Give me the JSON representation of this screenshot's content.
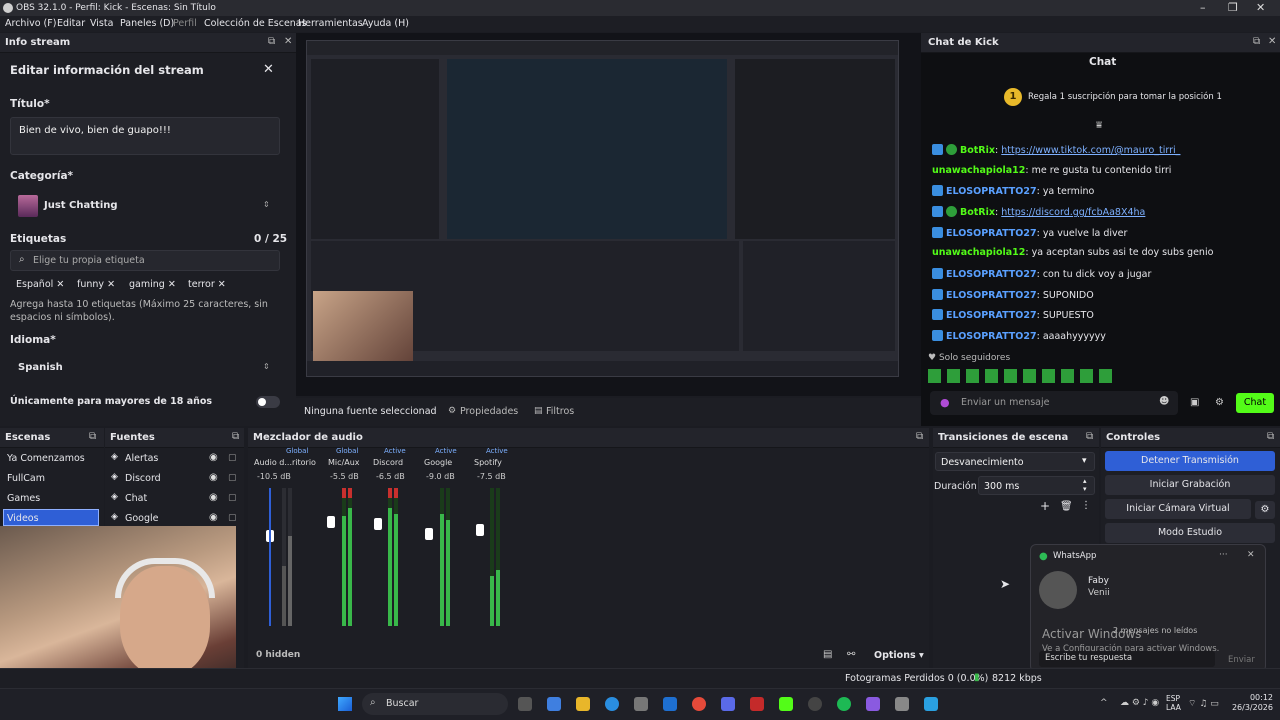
{
  "window": {
    "title": "OBS 32.1.0 - Perfil: Kick - Escenas: Sin Título"
  },
  "menu": [
    "Archivo (F)",
    "Editar",
    "Vista",
    "Paneles (D)",
    "Perfil",
    "Colección de Escenas",
    "Herramientas",
    "Ayuda (H)"
  ],
  "info_stream": {
    "dock_title": "Info stream",
    "heading": "Editar información del stream",
    "title_label": "Título*",
    "title_value": "Bien de vivo, bien de guapo!!!",
    "category_label": "Categoría*",
    "category_value": "Just Chatting",
    "tags_label": "Etiquetas",
    "tags_count": "0 / 25",
    "tags_placeholder": "Elige tu propia etiqueta",
    "tags": [
      "Español",
      "funny",
      "gaming",
      "terror"
    ],
    "tags_hint": "Agrega hasta 10 etiquetas (Máximo 25 caracteres, sin espacios ni símbolos).",
    "language_label": "Idioma*",
    "language_value": "Spanish",
    "adults_label": "Únicamente para mayores de 18 años"
  },
  "preview": {
    "no_source": "Ninguna fuente seleccionad",
    "properties": "Propiedades",
    "filters": "Filtros"
  },
  "chat": {
    "dock_title": "Chat de Kick",
    "header": "Chat",
    "pinned": "Regala 1 suscripción para tomar la posición 1",
    "messages": [
      {
        "user": "BotRix",
        "sep": ": ",
        "text": "https://www.tiktok.com/@mauro_tirri_",
        "link": true,
        "bot": true
      },
      {
        "user": "unawachapiola12",
        "sep": ": ",
        "text": "me re gusta tu contenido tirri",
        "link": false,
        "bot": false
      },
      {
        "user": "ELOSOPRATTO27",
        "sep": ": ",
        "text": "ya termino",
        "link": false,
        "bot": false
      },
      {
        "user": "BotRix",
        "sep": ": ",
        "text": "https://discord.gg/fcbAa8X4ha",
        "link": true,
        "bot": true
      },
      {
        "user": "ELOSOPRATTO27",
        "sep": ": ",
        "text": "ya vuelve la diver",
        "link": false,
        "bot": false
      },
      {
        "user": "unawachapiola12",
        "sep": ": ",
        "text": "ya aceptan subs asi te doy subs genio",
        "link": false,
        "bot": false
      },
      {
        "user": "ELOSOPRATTO27",
        "sep": ": ",
        "text": "con tu dick voy a jugar",
        "link": false,
        "bot": false
      },
      {
        "user": "ELOSOPRATTO27",
        "sep": ": ",
        "text": "SUPONIDO",
        "link": false,
        "bot": false
      },
      {
        "user": "ELOSOPRATTO27",
        "sep": ": ",
        "text": "SUPUESTO",
        "link": false,
        "bot": false
      },
      {
        "user": "ELOSOPRATTO27",
        "sep": ": ",
        "text": "aaaahyyyyyy",
        "link": false,
        "bot": false
      }
    ],
    "followers_only": "Solo seguidores",
    "input_placeholder": "Enviar un mensaje",
    "send": "Chat"
  },
  "scenes": {
    "title": "Escenas",
    "items": [
      "Ya Comenzamos",
      "FullCam",
      "Games",
      "Videos"
    ],
    "selected": 3
  },
  "sources": {
    "title": "Fuentes",
    "items": [
      "Alertas",
      "Discord",
      "Chat",
      "Google"
    ]
  },
  "mixer": {
    "title": "Mezclador de audio",
    "channels": [
      {
        "tag": "Global",
        "name": "Audio d...ritorio",
        "db": "-10.5 dB"
      },
      {
        "tag": "Global",
        "name": "Mic/Aux",
        "db": "-5.5 dB"
      },
      {
        "tag": "Active",
        "name": "Discord",
        "db": "-6.5 dB"
      },
      {
        "tag": "Active",
        "name": "Google",
        "db": "-9.0 dB"
      },
      {
        "tag": "Active",
        "name": "Spotify",
        "db": "-7.5 dB"
      }
    ],
    "scale": [
      "0",
      "-6",
      "-12",
      "-18",
      "-24",
      "-30",
      "-36",
      "-42",
      "-48",
      "-54",
      "-60"
    ],
    "hidden": "0 hidden",
    "options": "Options"
  },
  "transitions": {
    "title": "Transiciones de escena",
    "type": "Desvanecimiento",
    "duration_label": "Duración",
    "duration_value": "300 ms"
  },
  "controls": {
    "title": "Controles",
    "stop_stream": "Detener Transmisión",
    "start_recording": "Iniciar Grabación",
    "virtual_cam": "Iniciar Cámara Virtual",
    "studio_mode": "Modo Estudio"
  },
  "notification": {
    "app": "WhatsApp",
    "sender": "Faby",
    "message": "Venii",
    "unread": "2 mensajes no leídos",
    "reply_placeholder": "Escribe tu respuesta",
    "send": "Enviar",
    "activate_title": "Activar Windows",
    "activate_sub": "Ve a Configuración para activar Windows."
  },
  "status": {
    "dropped": "Fotogramas Perdidos 0 (0.0%)",
    "bitrate": "8212 kbps"
  },
  "taskbar": {
    "search": "Buscar",
    "lang1": "ESP",
    "lang2": "LAA",
    "time": "00:12",
    "date": "26/3/2026"
  },
  "colors": {
    "accent": "#2f5fd6",
    "kick_green": "#53fc18",
    "link": "#7db0ff"
  }
}
